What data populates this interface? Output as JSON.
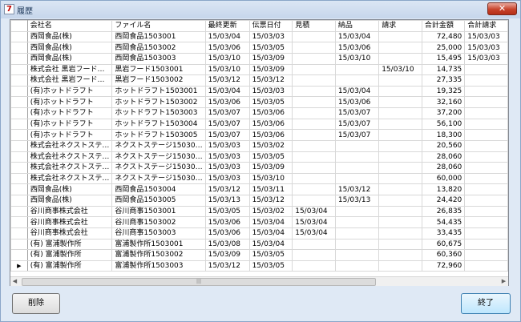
{
  "window": {
    "title": "履歴",
    "app_icon_glyph": "7",
    "close_glyph": "✕"
  },
  "grid": {
    "columns": [
      "会社名",
      "ファイル名",
      "最終更新",
      "伝票日付",
      "見積",
      "納品",
      "請求",
      "合計金額",
      "合計請求"
    ],
    "current_row_marker": "▶",
    "rows": [
      [
        "西岡食品(株)",
        "西岡食品1503001",
        "15/03/04",
        "15/03/03",
        "",
        "15/03/04",
        "",
        "72,480",
        "15/03/03"
      ],
      [
        "西岡食品(株)",
        "西岡食品1503002",
        "15/03/06",
        "15/03/05",
        "",
        "15/03/06",
        "",
        "25,000",
        "15/03/03"
      ],
      [
        "西岡食品(株)",
        "西岡食品1503003",
        "15/03/10",
        "15/03/09",
        "",
        "15/03/10",
        "",
        "15,495",
        "15/03/03"
      ],
      [
        "株式会社 黒岩フード…",
        "黒岩フード1503001",
        "15/03/10",
        "15/03/09",
        "",
        "",
        "15/03/10",
        "14,735",
        ""
      ],
      [
        "株式会社 黒岩フード…",
        "黒岩フード1503002",
        "15/03/12",
        "15/03/12",
        "",
        "",
        "",
        "27,335",
        ""
      ],
      [
        "(有)ホットドラフト",
        "ホットドラフト1503001",
        "15/03/04",
        "15/03/03",
        "",
        "15/03/04",
        "",
        "19,325",
        ""
      ],
      [
        "(有)ホットドラフト",
        "ホットドラフト1503002",
        "15/03/06",
        "15/03/05",
        "",
        "15/03/06",
        "",
        "32,160",
        ""
      ],
      [
        "(有)ホットドラフト",
        "ホットドラフト1503003",
        "15/03/07",
        "15/03/06",
        "",
        "15/03/07",
        "",
        "37,200",
        ""
      ],
      [
        "(有)ホットドラフト",
        "ホットドラフト1503004",
        "15/03/07",
        "15/03/06",
        "",
        "15/03/07",
        "",
        "56,100",
        ""
      ],
      [
        "(有)ホットドラフト",
        "ホットドラフト1503005",
        "15/03/07",
        "15/03/06",
        "",
        "15/03/07",
        "",
        "18,300",
        ""
      ],
      [
        "株式会社ネクストステ…",
        "ネクストステージ15030…",
        "15/03/03",
        "15/03/02",
        "",
        "",
        "",
        "20,560",
        ""
      ],
      [
        "株式会社ネクストステ…",
        "ネクストステージ15030…",
        "15/03/03",
        "15/03/05",
        "",
        "",
        "",
        "28,060",
        ""
      ],
      [
        "株式会社ネクストステ…",
        "ネクストステージ15030…",
        "15/03/03",
        "15/03/09",
        "",
        "",
        "",
        "28,060",
        ""
      ],
      [
        "株式会社ネクストステ…",
        "ネクストステージ15030…",
        "15/03/03",
        "15/03/10",
        "",
        "",
        "",
        "60,000",
        ""
      ],
      [
        "西岡食品(株)",
        "西岡食品1503004",
        "15/03/12",
        "15/03/11",
        "",
        "15/03/12",
        "",
        "13,820",
        ""
      ],
      [
        "西岡食品(株)",
        "西岡食品1503005",
        "15/03/13",
        "15/03/12",
        "",
        "15/03/13",
        "",
        "24,420",
        ""
      ],
      [
        "谷川商事株式会社",
        "谷川商事1503001",
        "15/03/05",
        "15/03/02",
        "15/03/04",
        "",
        "",
        "26,835",
        ""
      ],
      [
        "谷川商事株式会社",
        "谷川商事1503002",
        "15/03/06",
        "15/03/04",
        "15/03/04",
        "",
        "",
        "54,435",
        ""
      ],
      [
        "谷川商事株式会社",
        "谷川商事1503003",
        "15/03/06",
        "15/03/04",
        "15/03/04",
        "",
        "",
        "33,435",
        ""
      ],
      [
        "(有) 富浦製作所",
        "富浦製作所1503001",
        "15/03/08",
        "15/03/04",
        "",
        "",
        "",
        "60,675",
        ""
      ],
      [
        "(有) 富浦製作所",
        "富浦製作所1503002",
        "15/03/09",
        "15/03/05",
        "",
        "",
        "",
        "60,360",
        ""
      ],
      [
        "(有) 富浦製作所",
        "富浦製作所1503003",
        "15/03/12",
        "15/03/05",
        "",
        "",
        "",
        "72,960",
        ""
      ]
    ]
  },
  "scrollbar": {
    "left_glyph": "◀",
    "right_glyph": "▶",
    "grip_glyph": "|||"
  },
  "buttons": {
    "delete_label": "削除",
    "close_label": "終了"
  }
}
